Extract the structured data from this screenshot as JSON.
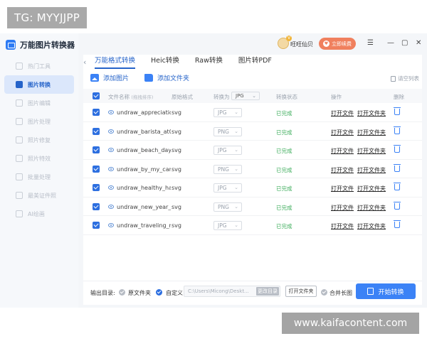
{
  "watermarks": {
    "top": "TG: MYYJJPP",
    "bottom": "www.kaifacontent.com"
  },
  "app": {
    "title": "万能图片转换器",
    "sidebar": {
      "items": [
        {
          "label": "热门工具",
          "active": false
        },
        {
          "label": "图片转换",
          "active": true
        },
        {
          "label": "图片编辑",
          "active": false
        },
        {
          "label": "图片处理",
          "active": false
        },
        {
          "label": "照片修复",
          "active": false
        },
        {
          "label": "照片特效",
          "active": false
        },
        {
          "label": "批量处理",
          "active": false
        },
        {
          "label": "最美证件照",
          "active": false
        },
        {
          "label": "AI绘画",
          "active": false
        }
      ]
    },
    "topbar": {
      "vip_badge": "V",
      "username": "旺旺仙贝",
      "renew_label": "立即续费",
      "window_controls": {
        "menu": "☰",
        "minimize": "—",
        "maximize": "▢",
        "close": "✕"
      }
    },
    "tabs": [
      {
        "label": "万能格式转换",
        "active": true
      },
      {
        "label": "Heic转换",
        "active": false
      },
      {
        "label": "Raw转换",
        "active": false
      },
      {
        "label": "图片转PDF",
        "active": false
      }
    ],
    "toolbar": {
      "add_image": "添加图片",
      "add_folder": "添加文件夹",
      "clear_list": "请空列表"
    },
    "table": {
      "headers": {
        "name": "文件名称",
        "name_hint": "(拖拽排序)",
        "orig_format": "原始格式",
        "convert_to": "转换为",
        "convert_to_value": "JPG",
        "status": "转换状态",
        "ops": "操作",
        "delete": "删除"
      },
      "rows": [
        {
          "name": "undraw_appreciatio...",
          "ext": "svg",
          "target": "JPG",
          "status": "已完成",
          "op1": "打开文件",
          "op2": "打开文件夹"
        },
        {
          "name": "undraw_barista_at0v",
          "ext": "svg",
          "target": "PNG",
          "status": "已完成",
          "op1": "打开文件",
          "op2": "打开文件夹"
        },
        {
          "name": "undraw_beach_day_...",
          "ext": "svg",
          "target": "JPG",
          "status": "已完成",
          "op1": "打开文件",
          "op2": "打开文件夹"
        },
        {
          "name": "undraw_by_my_car_...",
          "ext": "svg",
          "target": "PNG",
          "status": "已完成",
          "op1": "打开文件",
          "op2": "打开文件夹"
        },
        {
          "name": "undraw_healthy_hab...",
          "ext": "svg",
          "target": "JPG",
          "status": "已完成",
          "op1": "打开文件",
          "op2": "打开文件夹"
        },
        {
          "name": "undraw_new_year_2...",
          "ext": "svg",
          "target": "PNG",
          "status": "已完成",
          "op1": "打开文件",
          "op2": "打开文件夹"
        },
        {
          "name": "undraw_traveling_m...",
          "ext": "svg",
          "target": "JPG",
          "status": "已完成",
          "op1": "打开文件",
          "op2": "打开文件夹"
        }
      ]
    },
    "footer": {
      "output_label": "输出目录:",
      "original_folder": "原文件夹",
      "custom": "自定义",
      "path": "C:\\Users\\Micong\\Deskt...",
      "change_dir": "更改目录",
      "open_folder": "打开文件夹",
      "merge_long": "合并长图",
      "start": "开始转换"
    },
    "colors": {
      "accent": "#2563c9",
      "button": "#3b82f6",
      "done": "#3fae5d",
      "renew": "#f0805e"
    }
  }
}
